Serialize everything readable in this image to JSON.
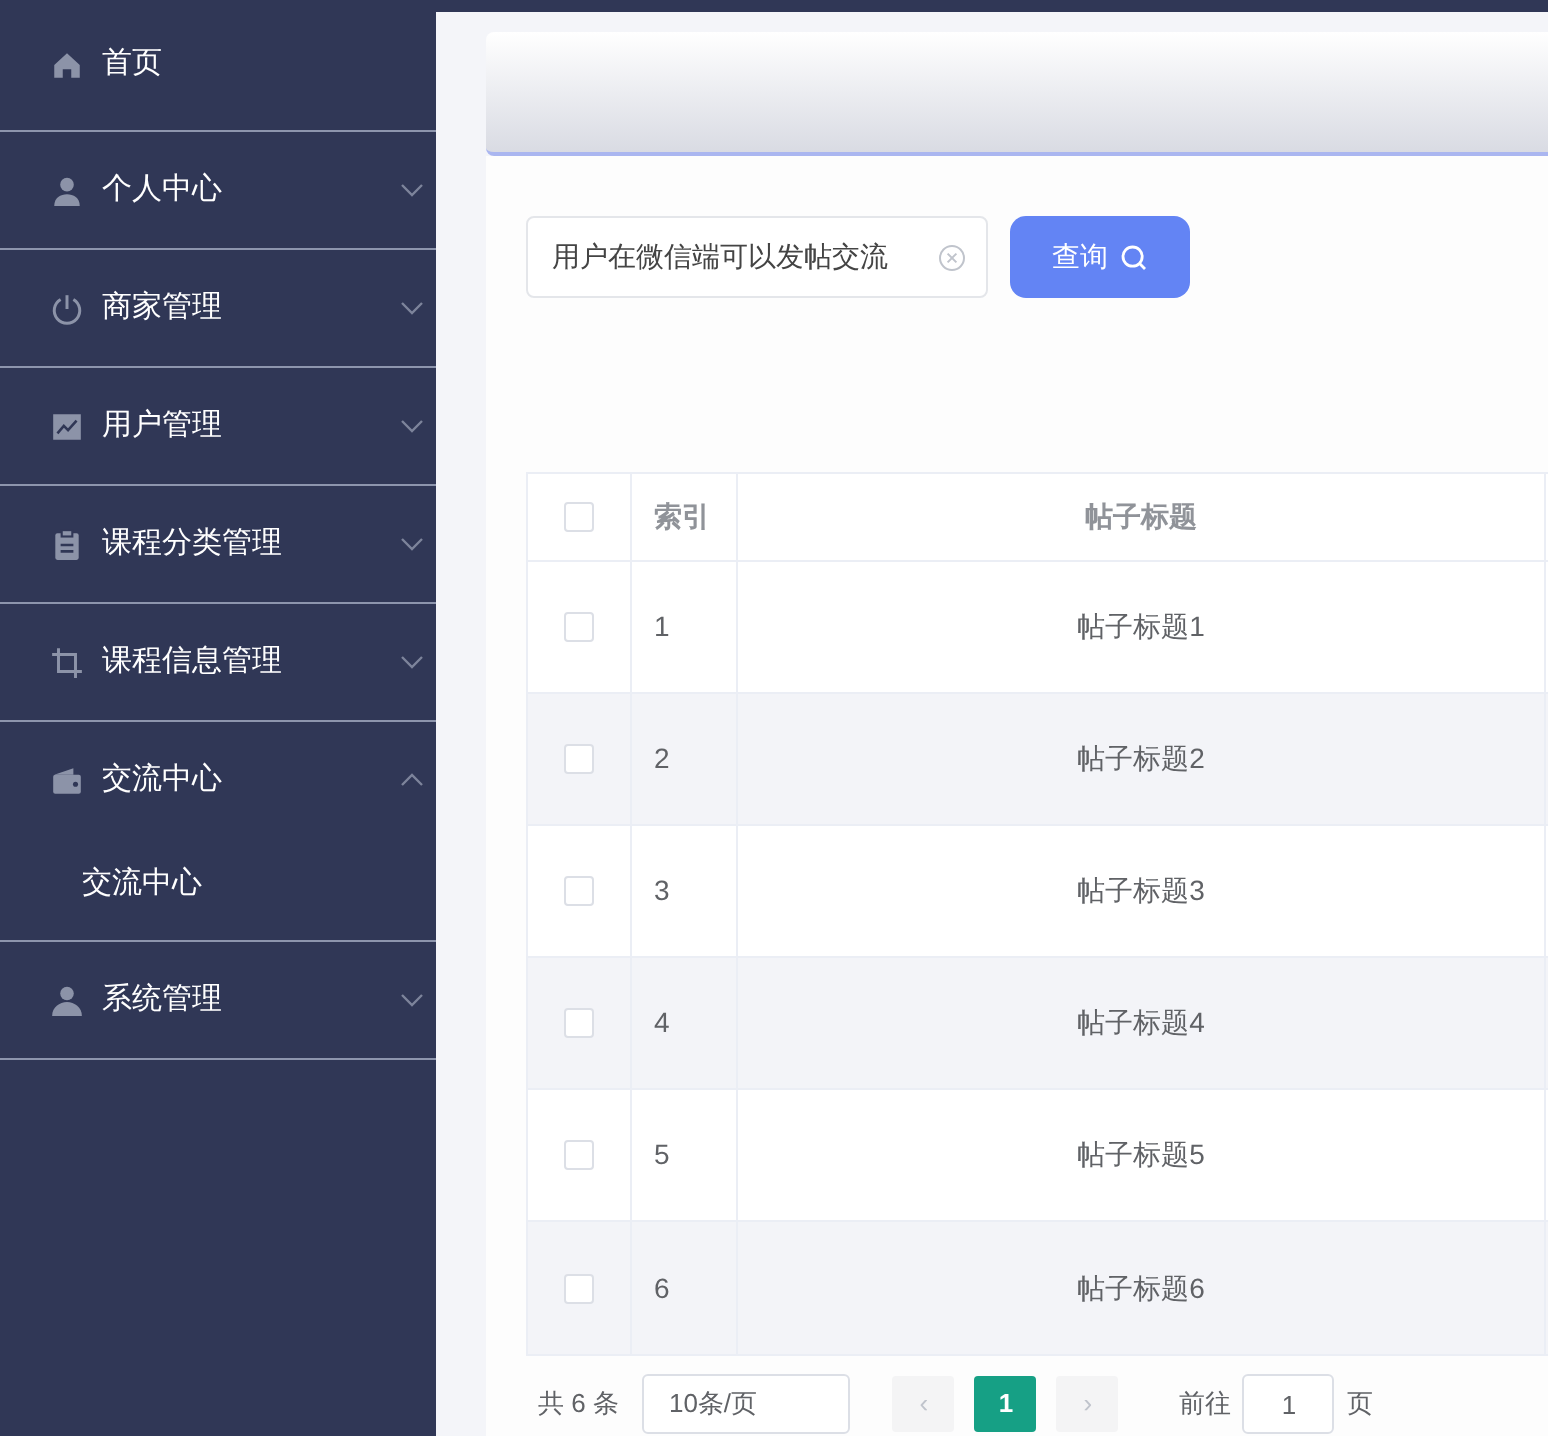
{
  "sidebar": {
    "items": [
      {
        "label": "首页",
        "expandable": false
      },
      {
        "label": "个人中心",
        "expandable": true,
        "expanded": false
      },
      {
        "label": "商家管理",
        "expandable": true,
        "expanded": false
      },
      {
        "label": "用户管理",
        "expandable": true,
        "expanded": false
      },
      {
        "label": "课程分类管理",
        "expandable": true,
        "expanded": false
      },
      {
        "label": "课程信息管理",
        "expandable": true,
        "expanded": false
      },
      {
        "label": "交流中心",
        "expandable": true,
        "expanded": true,
        "children": [
          {
            "label": "交流中心"
          }
        ]
      },
      {
        "label": "系统管理",
        "expandable": true,
        "expanded": false
      }
    ]
  },
  "search": {
    "value": "用户在微信端可以发帖交流",
    "button": "查询"
  },
  "table": {
    "all_checked": false,
    "columns": [
      "索引",
      "帖子标题"
    ],
    "rows": [
      {
        "checked": false,
        "index": "1",
        "title": "帖子标题1"
      },
      {
        "checked": false,
        "index": "2",
        "title": "帖子标题2"
      },
      {
        "checked": false,
        "index": "3",
        "title": "帖子标题3"
      },
      {
        "checked": false,
        "index": "4",
        "title": "帖子标题4"
      },
      {
        "checked": false,
        "index": "5",
        "title": "帖子标题5"
      },
      {
        "checked": false,
        "index": "6",
        "title": "帖子标题6"
      }
    ]
  },
  "pagination": {
    "total": "共 6 条",
    "page_size": "10条/页",
    "prev": "‹",
    "pages": [
      {
        "label": "1",
        "selected": true
      }
    ],
    "next": "›",
    "goto_label": "前往",
    "goto_value": "1",
    "goto_suffix": "页"
  }
}
